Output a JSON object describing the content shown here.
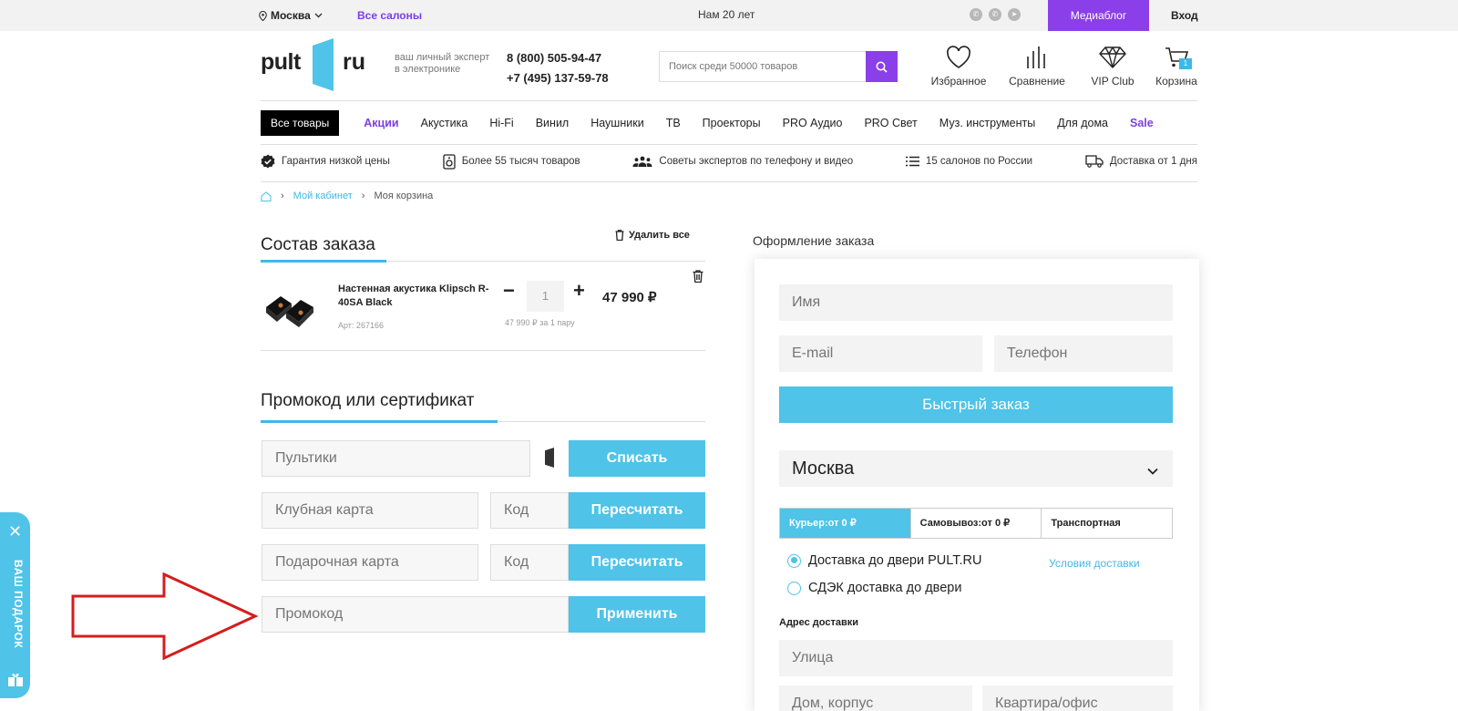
{
  "topbar": {
    "city": "Москва",
    "salons": "Все салоны",
    "years": "Нам 20 лет",
    "mediablog": "Медиаблог",
    "login": "Вход"
  },
  "header": {
    "logo_left": "pult",
    "logo_right": "ru",
    "tagline": "ваш личный эксперт в электронике",
    "phone1": "8 (800) 505-94-47",
    "phone2": "+7 (495) 137-59-78",
    "search_placeholder": "Поиск среди 50000 товаров",
    "favorites": "Избранное",
    "compare": "Сравнение",
    "vip": "VIP Club",
    "cart": "Корзина",
    "cart_count": "1"
  },
  "catnav": {
    "all": "Все товары",
    "items": [
      "Акции",
      "Акустика",
      "Hi-Fi",
      "Винил",
      "Наушники",
      "ТВ",
      "Проекторы",
      "PRO Аудио",
      "PRO Свет",
      "Муз. инструменты",
      "Для дома",
      "Sale"
    ]
  },
  "perks": [
    "Гарантия низкой цены",
    "Более 55 тысяч товаров",
    "Советы экспертов по телефону и видео",
    "15 салонов по России",
    "Доставка от 1 дня"
  ],
  "breadcrumb": {
    "cabinet": "Мой кабинет",
    "current": "Моя корзина"
  },
  "order": {
    "title": "Состав заказа",
    "delete_all": "Удалить все",
    "product_name": "Настенная акустика Klipsch R-40SA Black",
    "article": "Арт: 267166",
    "qty": "1",
    "price": "47 990 ₽",
    "unit_price": "47 990 ₽ за 1 пару"
  },
  "promo": {
    "title": "Промокод или сертификат",
    "pultiki_placeholder": "Пультики",
    "write_off": "Списать",
    "club_placeholder": "Клубная карта",
    "code_placeholder": "Код",
    "recalc": "Пересчитать",
    "gift_placeholder": "Подарочная карта",
    "promo_placeholder": "Промокод",
    "apply": "Применить"
  },
  "gift_tab": {
    "label": "ВАШ ПОДАРОК"
  },
  "checkout": {
    "title": "Оформление заказа",
    "name_placeholder": "Имя",
    "email_placeholder": "E-mail",
    "phone_placeholder": "Телефон",
    "quick_order": "Быстрый заказ",
    "city": "Москва",
    "tabs": [
      "Курьер:от 0 ₽",
      "Самовывоз:от 0 ₽",
      "Транспортная"
    ],
    "radio1": "Доставка до двери PULT.RU",
    "radio2": "СДЭК доставка до двери",
    "conditions": "Условия доставки",
    "address_label": "Адрес доставки",
    "street_placeholder": "Улица",
    "house_placeholder": "Дом, корпус",
    "flat_placeholder": "Квартира/офис"
  },
  "colors": {
    "accent_purple": "#8b3fe8",
    "accent_blue": "#4fc3e8"
  }
}
